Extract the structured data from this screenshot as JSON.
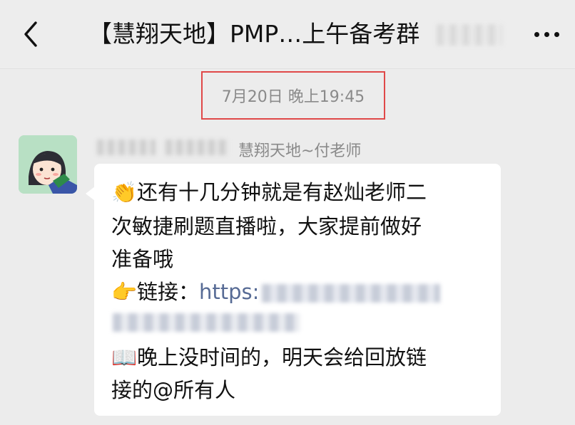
{
  "header": {
    "title": "【慧翔天地】PMP…上午备考群",
    "back_icon": "chevron-left-icon",
    "more_icon": "more-dots-icon"
  },
  "chat": {
    "timestamp": "7月20日 晚上19:45",
    "message": {
      "sender_name": "慧翔天地~付老师",
      "line1": "还有十几分钟就是有赵灿老师二",
      "line2": "次敏捷刷题直播啦，大家提前做好",
      "line3": "准备哦",
      "link_label": "链接：",
      "link_prefix": "https:",
      "line6": "晚上没时间的，明天会给回放链",
      "line7": "接的@所有人",
      "emoji1": "👏",
      "emoji2": "👉",
      "emoji3": "📖"
    }
  },
  "colors": {
    "background": "#ececec",
    "bubble": "#ffffff",
    "link": "#576b95",
    "timestamp": "#8a8a8a",
    "highlight_box": "#e04848"
  }
}
